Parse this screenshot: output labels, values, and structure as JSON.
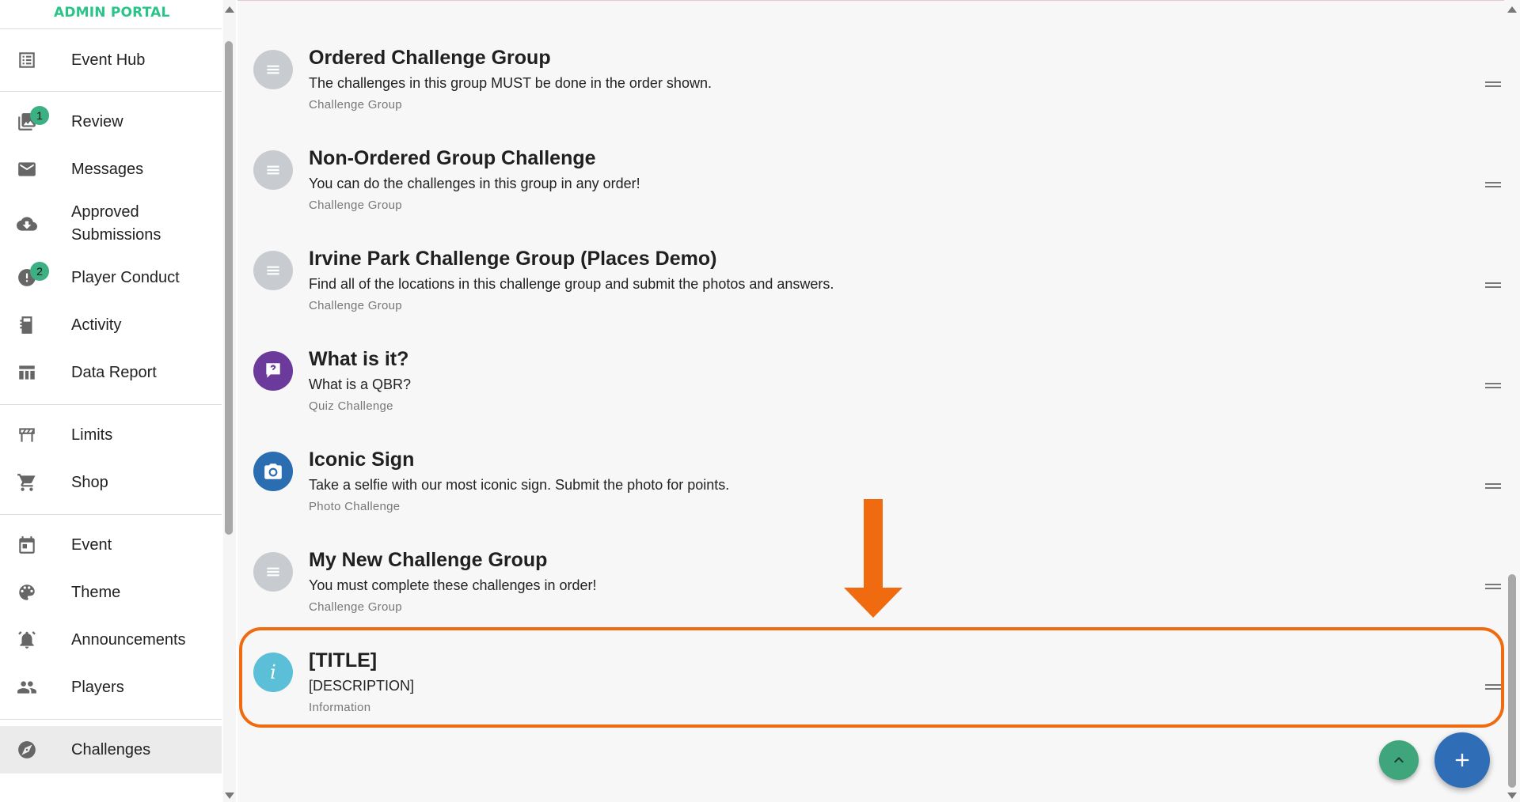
{
  "brand": {
    "logo_text": "ADMIN PORTAL"
  },
  "sidebar": {
    "items": [
      {
        "label": "Event Hub",
        "icon": "list-icon"
      },
      {
        "label": "Review",
        "icon": "photo-library-icon",
        "badge": "1"
      },
      {
        "label": "Messages",
        "icon": "mail-icon"
      },
      {
        "label": "Approved Submissions",
        "icon": "cloud-download-icon"
      },
      {
        "label": "Player Conduct",
        "icon": "alert-icon",
        "badge": "2"
      },
      {
        "label": "Activity",
        "icon": "activity-icon"
      },
      {
        "label": "Data Report",
        "icon": "table-icon"
      },
      {
        "label": "Limits",
        "icon": "barrier-icon"
      },
      {
        "label": "Shop",
        "icon": "cart-icon"
      },
      {
        "label": "Event",
        "icon": "calendar-icon"
      },
      {
        "label": "Theme",
        "icon": "palette-icon"
      },
      {
        "label": "Announcements",
        "icon": "bell-icon"
      },
      {
        "label": "Players",
        "icon": "people-icon"
      },
      {
        "label": "Challenges",
        "icon": "compass-icon",
        "active": true
      }
    ]
  },
  "challenges": [
    {
      "title": "Ordered Challenge Group",
      "description": "The challenges in this group MUST be done in the order shown.",
      "type": "Challenge Group",
      "icon": "group-icon",
      "color": "#c8ccd0"
    },
    {
      "title": "Non-Ordered Group Challenge",
      "description": "You can do the challenges in this group in any order!",
      "type": "Challenge Group",
      "icon": "group-icon",
      "color": "#c8ccd0"
    },
    {
      "title": "Irvine Park Challenge Group (Places Demo)",
      "description": "Find all of the locations in this challenge group and submit the photos and answers.",
      "type": "Challenge Group",
      "icon": "group-icon",
      "color": "#c8ccd0"
    },
    {
      "title": "What is it?",
      "description": "What is a QBR?",
      "type": "Quiz Challenge",
      "icon": "quiz-icon",
      "color": "#6b3a9a"
    },
    {
      "title": "Iconic Sign",
      "description": "Take a selfie with our most iconic sign. Submit the photo for points.",
      "type": "Photo Challenge",
      "icon": "camera-icon",
      "color": "#2a6db0"
    },
    {
      "title": "My New Challenge Group",
      "description": "You must complete these challenges in order!",
      "type": "Challenge Group",
      "icon": "group-icon",
      "color": "#c8ccd0"
    },
    {
      "title": "[TITLE]",
      "description": "[DESCRIPTION]",
      "type": "Information",
      "icon": "info-icon",
      "color": "#5bbfd8"
    }
  ],
  "colors": {
    "highlight": "#f06a10",
    "fab_add": "#2f6db7",
    "fab_up": "#3fa57a"
  }
}
